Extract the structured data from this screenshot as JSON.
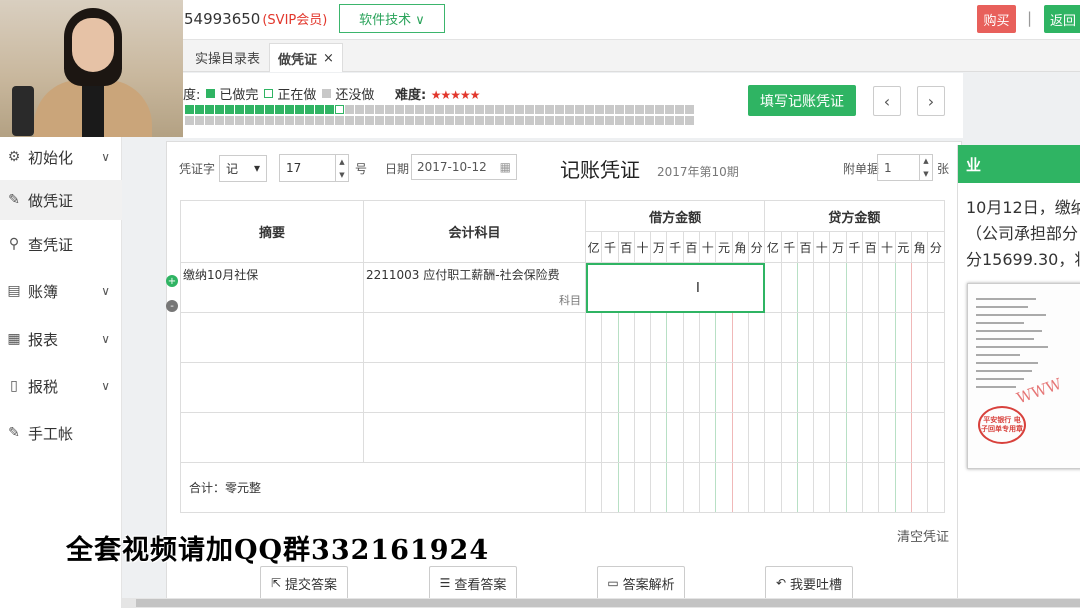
{
  "header": {
    "user_id": "54993650",
    "vip_label": "(SVIP会员)",
    "software_menu": "软件技术 ∨",
    "buy_label": "购买",
    "separator": "|",
    "back_label": "返回"
  },
  "tabs": [
    {
      "label": "实操目录表"
    },
    {
      "label": "做凭证",
      "close": "×"
    }
  ],
  "progress": {
    "legend_prefix": "度:",
    "done_label": "已做完",
    "doing_label": "正在做",
    "todo_label": "还没做",
    "difficulty_label": "难度:",
    "difficulty_stars": "★★★★★",
    "done_count": 15,
    "current_index": 15,
    "total_cells": 102,
    "fill_button": "填写记账凭证",
    "prev_icon": "‹",
    "next_icon": "›"
  },
  "sidebar": {
    "items": [
      {
        "label": "初始化",
        "icon": "gear-icon",
        "expand": true
      },
      {
        "label": "做凭证",
        "icon": "pen-icon",
        "expand": false
      },
      {
        "label": "查凭证",
        "icon": "search-icon",
        "expand": false
      },
      {
        "label": "账簿",
        "icon": "book-icon",
        "expand": true
      },
      {
        "label": "报表",
        "icon": "report-icon",
        "expand": true
      },
      {
        "label": "报税",
        "icon": "file-icon",
        "expand": true
      },
      {
        "label": "手工帐",
        "icon": "pen-icon",
        "expand": false
      }
    ]
  },
  "voucher": {
    "type_label": "凭证字",
    "type_value": "记",
    "number_value": "17",
    "number_suffix": "号",
    "date_label": "日期",
    "date_value": "2017-10-12",
    "title": "记账凭证",
    "period": "2017年第10期",
    "attach_label": "附单据",
    "attach_value": "1",
    "attach_unit": "张",
    "col_summary": "摘要",
    "col_account": "会计科目",
    "col_debit": "借方金额",
    "col_credit": "贷方金额",
    "digit_units": [
      "亿",
      "千",
      "百",
      "十",
      "万",
      "千",
      "百",
      "十",
      "元",
      "角",
      "分"
    ],
    "rows": [
      {
        "summary": "缴纳10月社保",
        "account": "2211003 应付职工薪酬-社会保险费",
        "account_hint": "科目"
      },
      {
        "summary": "",
        "account": "",
        "account_hint": ""
      },
      {
        "summary": "",
        "account": "",
        "account_hint": ""
      },
      {
        "summary": "",
        "account": "",
        "account_hint": ""
      }
    ],
    "total_label": "合计：零元整",
    "add_row_icon": "+",
    "del_row_icon": "-",
    "clear_link": "清空凭证"
  },
  "actions": {
    "submit": "提交答案",
    "view": "查看答案",
    "analysis": "答案解析",
    "feedback": "我要吐槽"
  },
  "overlay_text": "全套视频请加QQ群332161924",
  "right_panel": {
    "header": "业",
    "text_lines": [
      "10月12日，缴纳",
      "（公司承担部分",
      "分15699.30，将"
    ],
    "stamp_text": "平安银行 电子回单专用章",
    "watermark": "WWW"
  },
  "colors": {
    "accent": "#2fb463",
    "danger": "#e8605b",
    "vip": "#e2372c"
  }
}
